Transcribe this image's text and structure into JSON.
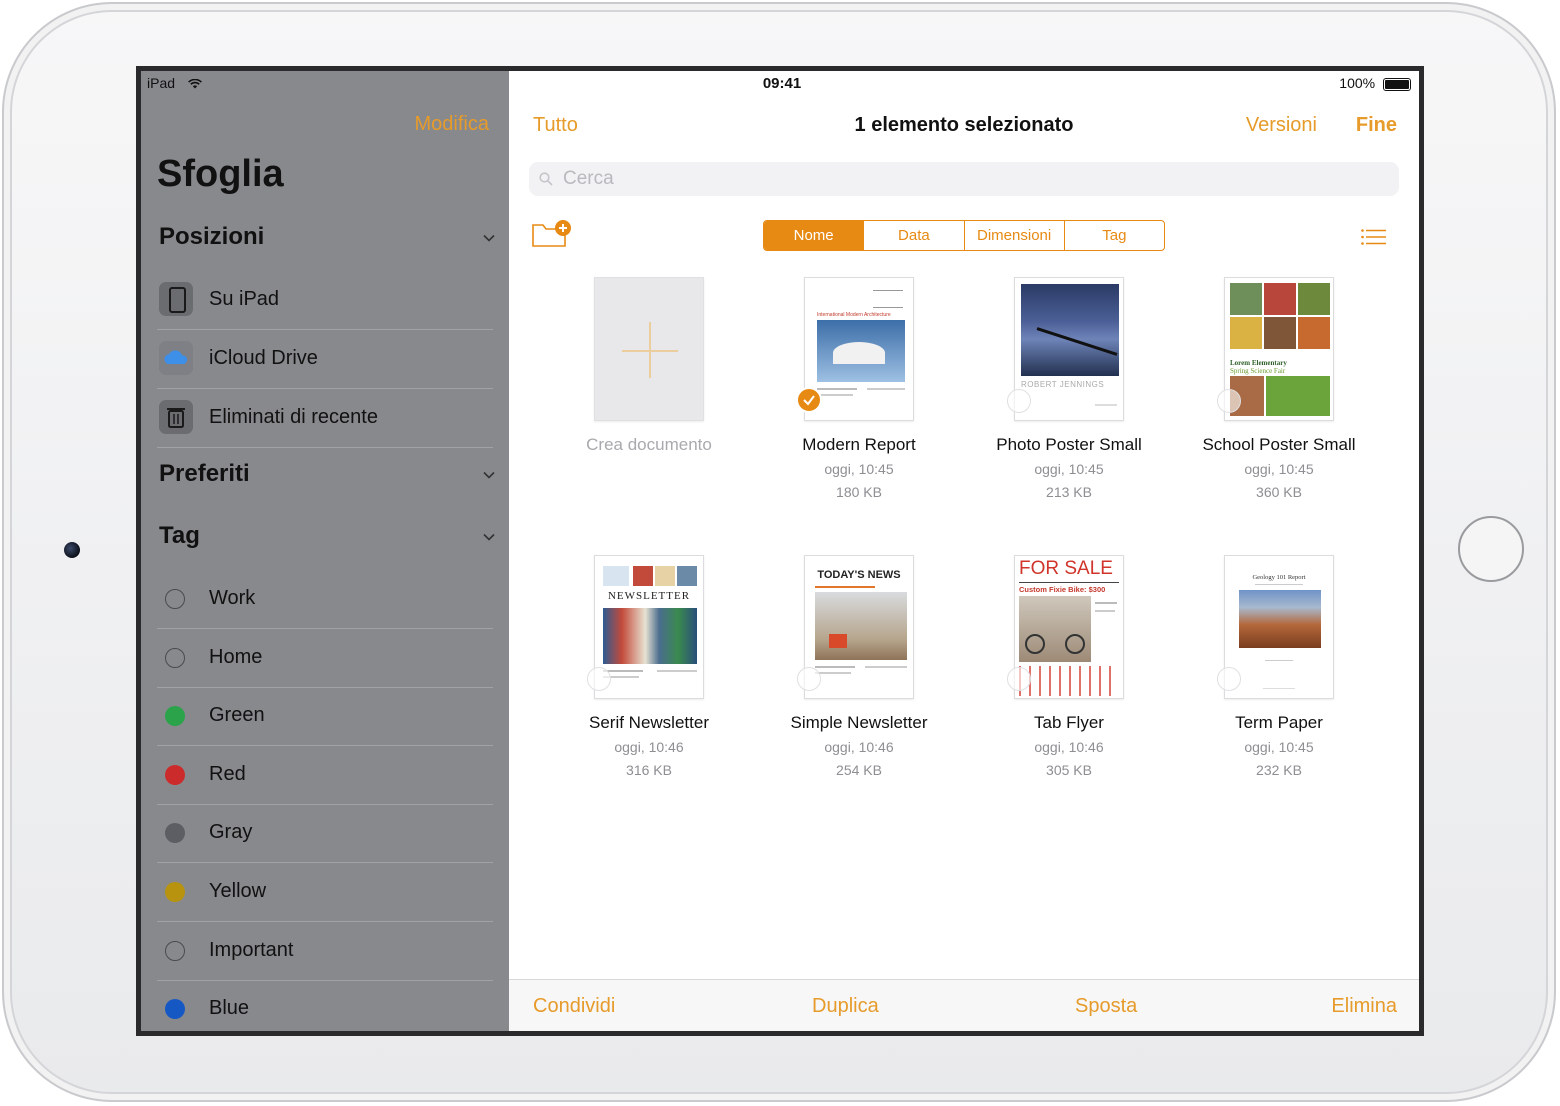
{
  "status": {
    "device": "iPad",
    "time": "09:41",
    "battery": "100%"
  },
  "sidebar": {
    "edit": "Modifica",
    "title": "Sfoglia",
    "locations_header": "Posizioni",
    "locations": [
      {
        "label": "Su iPad",
        "icon": "ipad-icon"
      },
      {
        "label": "iCloud Drive",
        "icon": "icloud-icon"
      },
      {
        "label": "Eliminati di recente",
        "icon": "trash-icon"
      }
    ],
    "favorites_header": "Preferiti",
    "tags_header": "Tag",
    "tags": [
      {
        "label": "Work",
        "color": ""
      },
      {
        "label": "Home",
        "color": ""
      },
      {
        "label": "Green",
        "color": "#2aa34a"
      },
      {
        "label": "Red",
        "color": "#cc2b2b"
      },
      {
        "label": "Gray",
        "color": "#5d5e63"
      },
      {
        "label": "Yellow",
        "color": "#b8930f"
      },
      {
        "label": "Important",
        "color": ""
      },
      {
        "label": "Blue",
        "color": "#1558c4"
      }
    ]
  },
  "nav": {
    "all": "Tutto",
    "title": "1 elemento selezionato",
    "versions": "Versioni",
    "done": "Fine"
  },
  "search": {
    "placeholder": "Cerca"
  },
  "sort": {
    "options": [
      "Nome",
      "Data",
      "Dimensioni",
      "Tag"
    ],
    "selected": "Nome"
  },
  "create": {
    "label": "Crea documento"
  },
  "documents": [
    {
      "name": "Modern Report",
      "date": "oggi, 10:45",
      "size": "180 KB",
      "selected": true,
      "thumb_lines": [
        "International Modern Architecture"
      ]
    },
    {
      "name": "Photo Poster Small",
      "date": "oggi, 10:45",
      "size": "213 KB",
      "selected": false,
      "thumb_lines": [
        "ROBERT JENNINGS"
      ]
    },
    {
      "name": "School Poster Small",
      "date": "oggi, 10:45",
      "size": "360 KB",
      "selected": false,
      "thumb_lines": [
        "Lorem Elementary",
        "Spring Science Fair"
      ]
    },
    {
      "name": "Serif Newsletter",
      "date": "oggi, 10:46",
      "size": "316 KB",
      "selected": false,
      "thumb_lines": [
        "NEWSLETTER"
      ]
    },
    {
      "name": "Simple Newsletter",
      "date": "oggi, 10:46",
      "size": "254 KB",
      "selected": false,
      "thumb_lines": [
        "TODAY'S NEWS"
      ]
    },
    {
      "name": "Tab Flyer",
      "date": "oggi, 10:46",
      "size": "305 KB",
      "selected": false,
      "thumb_lines": [
        "FOR SALE",
        "Custom Fixie Bike: $300"
      ]
    },
    {
      "name": "Term Paper",
      "date": "oggi, 10:45",
      "size": "232 KB",
      "selected": false,
      "thumb_lines": [
        "Geology 101 Report"
      ]
    }
  ],
  "toolbar": {
    "share": "Condividi",
    "duplicate": "Duplica",
    "move": "Sposta",
    "delete": "Elimina"
  },
  "colors": {
    "accent": "#e78a13",
    "sidebar_bg": "#88898d"
  }
}
